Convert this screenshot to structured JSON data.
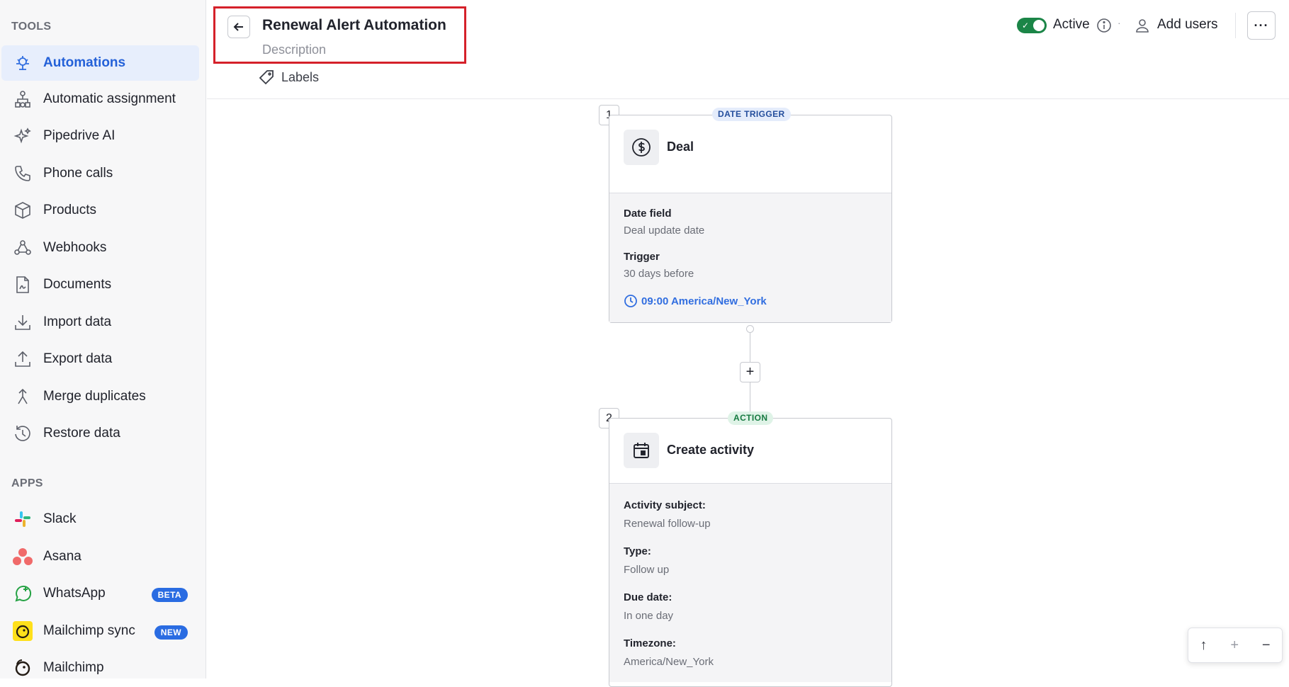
{
  "sidebar": {
    "tools_title": "TOOLS",
    "apps_title": "APPS",
    "tools": [
      {
        "label": "Automations",
        "icon": "automation-icon",
        "active": true
      },
      {
        "label": "Automatic assignment",
        "icon": "assignment-icon"
      },
      {
        "label": "Pipedrive AI",
        "icon": "sparkle-icon"
      },
      {
        "label": "Phone calls",
        "icon": "phone-icon"
      },
      {
        "label": "Products",
        "icon": "box-icon"
      },
      {
        "label": "Webhooks",
        "icon": "webhook-icon"
      },
      {
        "label": "Documents",
        "icon": "document-icon"
      },
      {
        "label": "Import data",
        "icon": "import-icon"
      },
      {
        "label": "Export data",
        "icon": "export-icon"
      },
      {
        "label": "Merge duplicates",
        "icon": "merge-icon"
      },
      {
        "label": "Restore data",
        "icon": "restore-icon"
      }
    ],
    "apps": [
      {
        "label": "Slack",
        "icon": "slack-icon"
      },
      {
        "label": "Asana",
        "icon": "asana-icon"
      },
      {
        "label": "WhatsApp",
        "icon": "whatsapp-icon",
        "badge": "BETA"
      },
      {
        "label": "Mailchimp sync",
        "icon": "mailchimp-icon",
        "badge": "NEW"
      },
      {
        "label": "Mailchimp",
        "icon": "mailchimp-icon"
      }
    ]
  },
  "header": {
    "title": "Renewal Alert Automation",
    "description_placeholder": "Description",
    "labels": "Labels",
    "status": "Active",
    "add_users": "Add users",
    "more": "···"
  },
  "workflow": {
    "trigger": {
      "number": "1",
      "pill": "DATE TRIGGER",
      "name": "Deal",
      "date_field_label": "Date field",
      "date_field_value": "Deal update date",
      "trigger_label": "Trigger",
      "trigger_value": "30 days before",
      "time": "09:00 America/New_York"
    },
    "add_step": "+",
    "action": {
      "number": "2",
      "pill": "ACTION",
      "name": "Create activity",
      "fields": [
        {
          "label": "Activity subject:",
          "value": "Renewal follow-up"
        },
        {
          "label": "Type:",
          "value": "Follow up"
        },
        {
          "label": "Due date:",
          "value": "In one day"
        },
        {
          "label": "Timezone:",
          "value": "America/New_York"
        }
      ]
    }
  },
  "zoom": {
    "up": "↑",
    "in": "+",
    "out": "−"
  },
  "colors": {
    "accent": "#316ee0",
    "active_toggle": "#1b8547",
    "highlight_box": "#d5212a",
    "badge": "#2a6ce2"
  }
}
